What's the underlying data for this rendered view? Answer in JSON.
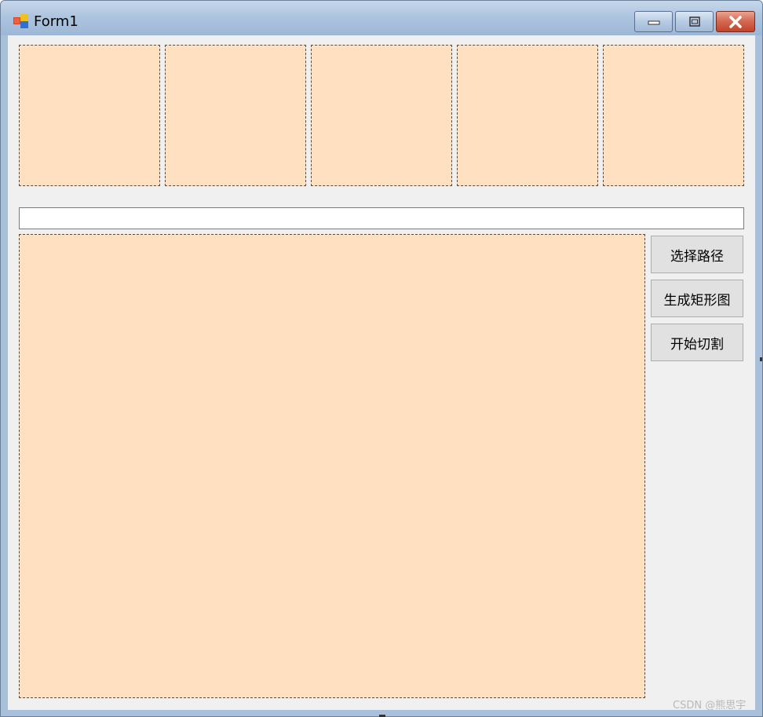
{
  "window": {
    "title": "Form1",
    "icons": {
      "app": "winforms-app-icon",
      "minimize": "minimize-icon",
      "maximize": "maximize-icon",
      "close": "close-icon"
    }
  },
  "thumbnails": [
    {
      "label": ""
    },
    {
      "label": ""
    },
    {
      "label": ""
    },
    {
      "label": ""
    },
    {
      "label": ""
    }
  ],
  "path_input": {
    "value": "",
    "placeholder": ""
  },
  "buttons": {
    "select_path": "选择路径",
    "generate_rect": "生成矩形图",
    "start_cut": "开始切割"
  },
  "watermark": "CSDN @熊思宇",
  "colors": {
    "picturebox_fill": "#ffe0c0",
    "client_bg": "#f0f0f0",
    "close_button": "#c2432b"
  }
}
